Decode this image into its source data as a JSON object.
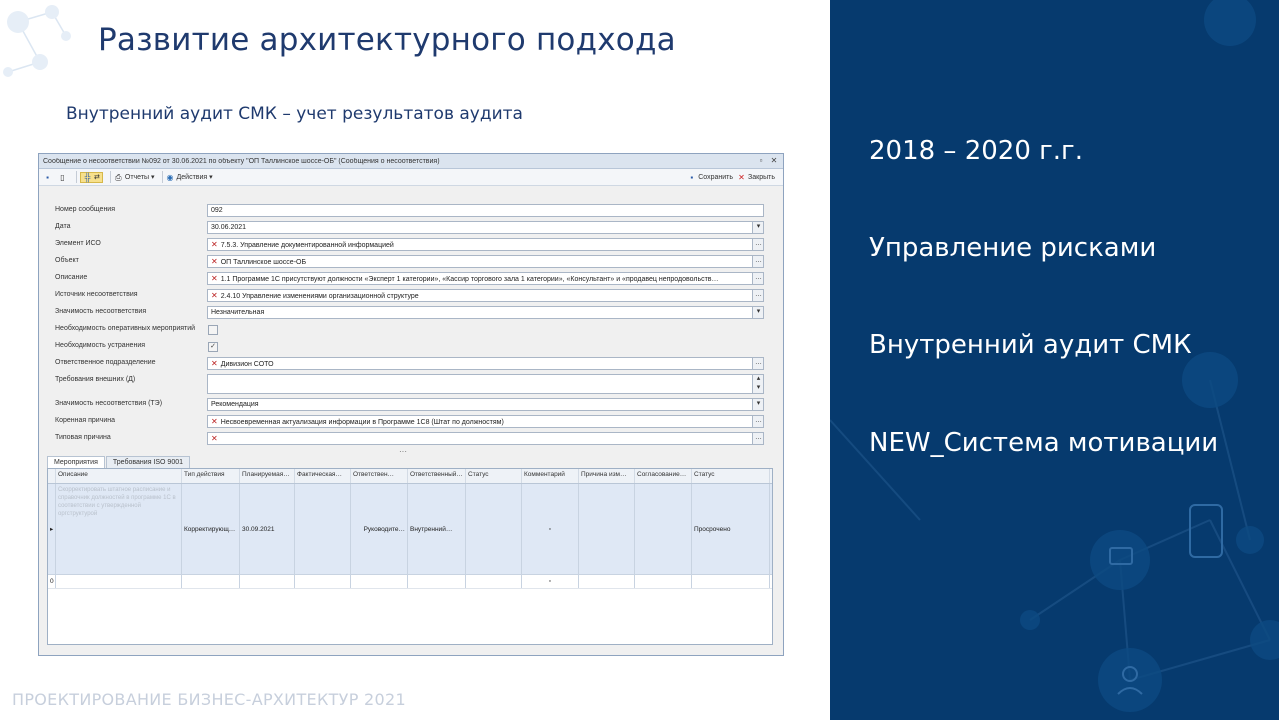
{
  "slide": {
    "title": "Развитие архитектурного подхода",
    "subtitle": "Внутренний аудит СМК – учет результатов аудита",
    "footer": "ПРОЕКТИРОВАНИЕ БИЗНЕС-АРХИТЕКТУР 2021"
  },
  "right_panel": {
    "items": [
      "2018 – 2020 г.г.",
      "Управление рисками",
      "Внутренний аудит СМК",
      "NEW_Система мотивации"
    ],
    "background_color": "#063a6e"
  },
  "window": {
    "title": "Сообщение о несоответствии №092 от 30.06.2021 по объекту \"ОП Таллинское шоссе-ОБ\" (Сообщения о несоответствия)",
    "toolbar": {
      "reports": "Отчеты",
      "actions": "Действия",
      "save": "Сохранить",
      "close": "Закрыть"
    },
    "form": [
      {
        "label": "Номер сообщения",
        "value": "092",
        "type": "text"
      },
      {
        "label": "Дата",
        "value": "30.06.2021",
        "type": "dropdown"
      },
      {
        "label": "Элемент ИСО",
        "value": "7.5.3. Управление документированной информацией",
        "type": "ref"
      },
      {
        "label": "Объект",
        "value": "ОП Таллинское шоссе-ОБ",
        "type": "ref"
      },
      {
        "label": "Описание",
        "value": "1.1 Программе 1С присутствуют должности «Эксперт 1 категории», «Кассир торгового зала 1 категории», «Консультант» и «продавец непродовольств…",
        "type": "ref"
      },
      {
        "label": "Источник несоответствия",
        "value": "2.4.10 Управление изменениями организационной структуре",
        "type": "ref"
      },
      {
        "label": "Значимость несоответствия",
        "value": "Незначительная",
        "type": "dropdown"
      },
      {
        "label": "Необходимость оперативных мероприятий",
        "value": "",
        "type": "check",
        "checked": false
      },
      {
        "label": "Необходимость устранения",
        "value": "",
        "type": "check",
        "checked": true
      },
      {
        "label": "Ответственное подразделение",
        "value": "Дивизион СОТО",
        "type": "ref"
      },
      {
        "label": "Требования внешних (Д)",
        "value": "",
        "type": "memo"
      },
      {
        "label": "Значимость несоответствия (ТЭ)",
        "value": "Рекомендация",
        "type": "dropdown"
      },
      {
        "label": "Коренная причина",
        "value": "Несвоевременная актуализация информации в Программе 1С8 (Штат по должностям)",
        "type": "ref"
      },
      {
        "label": "Типовая причина",
        "value": "",
        "type": "ref"
      }
    ],
    "tabs": [
      "Мероприятия",
      "Требования ISO 9001"
    ],
    "grid": {
      "columns": [
        "Описание",
        "Тип действия",
        "Планируемая…",
        "Фактическая…",
        "Ответствен…",
        "Ответственный…",
        "Статус",
        "Комментарий",
        "Причина изм…",
        "Согласование…",
        "Статус"
      ],
      "rows": [
        {
          "description": "Скорректировать штатное расписание и справочник должностей в программе 1С в соответствии с утвержденной оргструктурой",
          "type": "Корректирующ…",
          "planned": "30.09.2021",
          "actual": "",
          "responsible": "Руководите…",
          "responsible_person": "Внутренний…",
          "status": "",
          "comment": "",
          "reason": "",
          "approval": "",
          "final_status": "Просрочено"
        }
      ],
      "new_row_marker": "0"
    }
  }
}
